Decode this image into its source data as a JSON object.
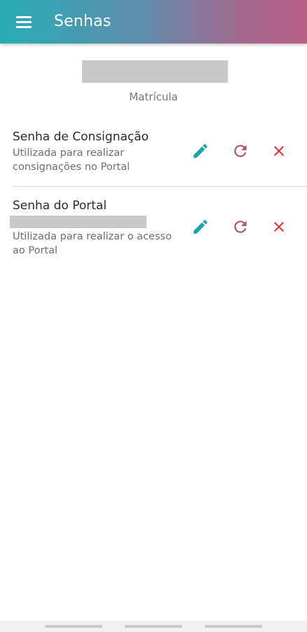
{
  "appbar": {
    "title": "Senhas",
    "menu_icon": "menu-icon"
  },
  "matricula": {
    "label": "Matrícula"
  },
  "passwords": [
    {
      "title": "Senha de Consignação",
      "description": "Utilizada para realizar consignações no Portal",
      "actions": [
        "edit-icon",
        "refresh-icon",
        "close-icon"
      ]
    },
    {
      "title": "Senha do Portal",
      "description": "Utilizada para realizar o acesso ao Portal",
      "actions": [
        "edit-icon",
        "refresh-icon",
        "close-icon"
      ]
    }
  ],
  "colors": {
    "edit": "#1f9fa8",
    "refresh": "#b0506c",
    "delete": "#e52b2b"
  }
}
